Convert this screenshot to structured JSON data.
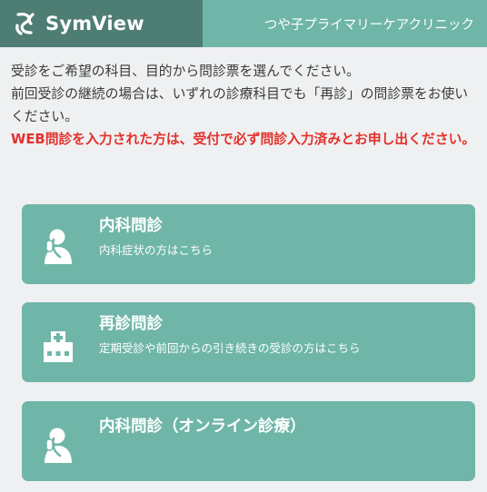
{
  "header": {
    "brand": "SymView",
    "clinic_name": "つや子プライマリーケアクリニック",
    "logo_icon": "symview-swirl-logo"
  },
  "intro": {
    "line1": "受診をご希望の科目、目的から問診票を選んでください。",
    "line2": "前回受診の継続の場合は、いずれの診療科目でも「再診」の問診票をお使いください。",
    "notice": "WEB問診を入力された方は、受付で必ず問診入力済みとお申し出ください。",
    "notice_color": "#e3312c"
  },
  "options": [
    {
      "title": "内科問診",
      "subtitle": "内科症状の方はこちら",
      "icon": "sick-person-icon"
    },
    {
      "title": "再診問診",
      "subtitle": "定期受診や前回からの引き続きの受診の方はこちら",
      "icon": "hospital-icon"
    },
    {
      "title": "内科問診（オンライン診療）",
      "subtitle": "",
      "icon": "sick-person-icon"
    }
  ],
  "colors": {
    "brand_bg": "#4e7d74",
    "accent": "#6fb6a8",
    "page_bg": "#eef0f1"
  }
}
